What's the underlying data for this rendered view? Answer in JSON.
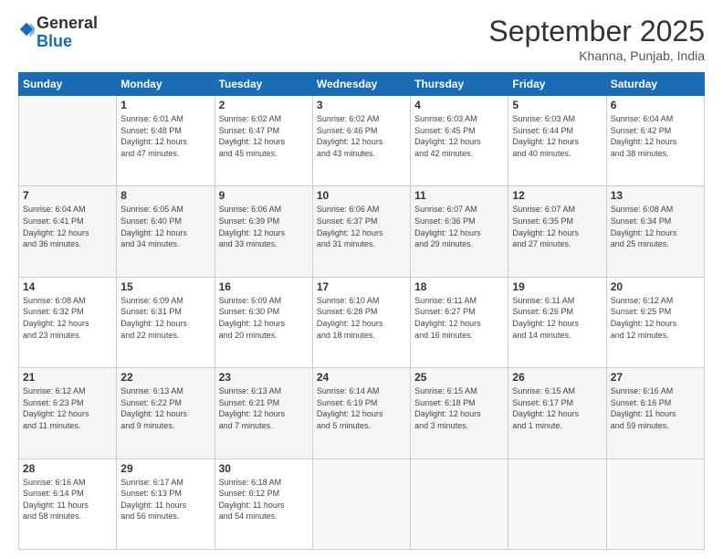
{
  "logo": {
    "general": "General",
    "blue": "Blue"
  },
  "title": "September 2025",
  "location": "Khanna, Punjab, India",
  "days_header": [
    "Sunday",
    "Monday",
    "Tuesday",
    "Wednesday",
    "Thursday",
    "Friday",
    "Saturday"
  ],
  "weeks": [
    [
      {
        "day": "",
        "info": ""
      },
      {
        "day": "1",
        "info": "Sunrise: 6:01 AM\nSunset: 6:48 PM\nDaylight: 12 hours\nand 47 minutes."
      },
      {
        "day": "2",
        "info": "Sunrise: 6:02 AM\nSunset: 6:47 PM\nDaylight: 12 hours\nand 45 minutes."
      },
      {
        "day": "3",
        "info": "Sunrise: 6:02 AM\nSunset: 6:46 PM\nDaylight: 12 hours\nand 43 minutes."
      },
      {
        "day": "4",
        "info": "Sunrise: 6:03 AM\nSunset: 6:45 PM\nDaylight: 12 hours\nand 42 minutes."
      },
      {
        "day": "5",
        "info": "Sunrise: 6:03 AM\nSunset: 6:44 PM\nDaylight: 12 hours\nand 40 minutes."
      },
      {
        "day": "6",
        "info": "Sunrise: 6:04 AM\nSunset: 6:42 PM\nDaylight: 12 hours\nand 38 minutes."
      }
    ],
    [
      {
        "day": "7",
        "info": "Sunrise: 6:04 AM\nSunset: 6:41 PM\nDaylight: 12 hours\nand 36 minutes."
      },
      {
        "day": "8",
        "info": "Sunrise: 6:05 AM\nSunset: 6:40 PM\nDaylight: 12 hours\nand 34 minutes."
      },
      {
        "day": "9",
        "info": "Sunrise: 6:06 AM\nSunset: 6:39 PM\nDaylight: 12 hours\nand 33 minutes."
      },
      {
        "day": "10",
        "info": "Sunrise: 6:06 AM\nSunset: 6:37 PM\nDaylight: 12 hours\nand 31 minutes."
      },
      {
        "day": "11",
        "info": "Sunrise: 6:07 AM\nSunset: 6:36 PM\nDaylight: 12 hours\nand 29 minutes."
      },
      {
        "day": "12",
        "info": "Sunrise: 6:07 AM\nSunset: 6:35 PM\nDaylight: 12 hours\nand 27 minutes."
      },
      {
        "day": "13",
        "info": "Sunrise: 6:08 AM\nSunset: 6:34 PM\nDaylight: 12 hours\nand 25 minutes."
      }
    ],
    [
      {
        "day": "14",
        "info": "Sunrise: 6:08 AM\nSunset: 6:32 PM\nDaylight: 12 hours\nand 23 minutes."
      },
      {
        "day": "15",
        "info": "Sunrise: 6:09 AM\nSunset: 6:31 PM\nDaylight: 12 hours\nand 22 minutes."
      },
      {
        "day": "16",
        "info": "Sunrise: 6:09 AM\nSunset: 6:30 PM\nDaylight: 12 hours\nand 20 minutes."
      },
      {
        "day": "17",
        "info": "Sunrise: 6:10 AM\nSunset: 6:28 PM\nDaylight: 12 hours\nand 18 minutes."
      },
      {
        "day": "18",
        "info": "Sunrise: 6:11 AM\nSunset: 6:27 PM\nDaylight: 12 hours\nand 16 minutes."
      },
      {
        "day": "19",
        "info": "Sunrise: 6:11 AM\nSunset: 6:26 PM\nDaylight: 12 hours\nand 14 minutes."
      },
      {
        "day": "20",
        "info": "Sunrise: 6:12 AM\nSunset: 6:25 PM\nDaylight: 12 hours\nand 12 minutes."
      }
    ],
    [
      {
        "day": "21",
        "info": "Sunrise: 6:12 AM\nSunset: 6:23 PM\nDaylight: 12 hours\nand 11 minutes."
      },
      {
        "day": "22",
        "info": "Sunrise: 6:13 AM\nSunset: 6:22 PM\nDaylight: 12 hours\nand 9 minutes."
      },
      {
        "day": "23",
        "info": "Sunrise: 6:13 AM\nSunset: 6:21 PM\nDaylight: 12 hours\nand 7 minutes."
      },
      {
        "day": "24",
        "info": "Sunrise: 6:14 AM\nSunset: 6:19 PM\nDaylight: 12 hours\nand 5 minutes."
      },
      {
        "day": "25",
        "info": "Sunrise: 6:15 AM\nSunset: 6:18 PM\nDaylight: 12 hours\nand 3 minutes."
      },
      {
        "day": "26",
        "info": "Sunrise: 6:15 AM\nSunset: 6:17 PM\nDaylight: 12 hours\nand 1 minute."
      },
      {
        "day": "27",
        "info": "Sunrise: 6:16 AM\nSunset: 6:16 PM\nDaylight: 11 hours\nand 59 minutes."
      }
    ],
    [
      {
        "day": "28",
        "info": "Sunrise: 6:16 AM\nSunset: 6:14 PM\nDaylight: 11 hours\nand 58 minutes."
      },
      {
        "day": "29",
        "info": "Sunrise: 6:17 AM\nSunset: 6:13 PM\nDaylight: 11 hours\nand 56 minutes."
      },
      {
        "day": "30",
        "info": "Sunrise: 6:18 AM\nSunset: 6:12 PM\nDaylight: 11 hours\nand 54 minutes."
      },
      {
        "day": "",
        "info": ""
      },
      {
        "day": "",
        "info": ""
      },
      {
        "day": "",
        "info": ""
      },
      {
        "day": "",
        "info": ""
      }
    ]
  ]
}
